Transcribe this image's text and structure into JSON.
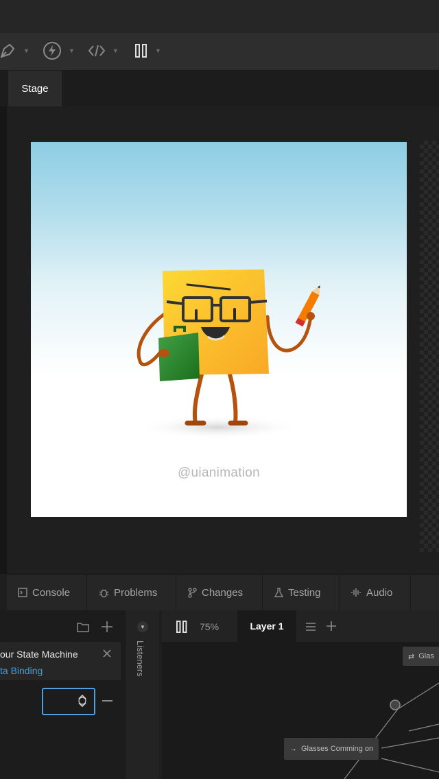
{
  "toolbar": {
    "icons": [
      "pen-icon",
      "bolt-icon",
      "code-icon",
      "pause-icon"
    ]
  },
  "stage_tab": {
    "label": "Stage"
  },
  "artboard": {
    "watermark": "@uianimation"
  },
  "bottom_tabs": [
    {
      "label": "Console",
      "icon": "console-icon"
    },
    {
      "label": "Problems",
      "icon": "bug-icon"
    },
    {
      "label": "Changes",
      "icon": "branch-icon"
    },
    {
      "label": "Testing",
      "icon": "flask-icon"
    },
    {
      "label": "Audio",
      "icon": "waveform-icon"
    }
  ],
  "left_panel": {
    "item_title": "our State Machine",
    "item_link": "ta Binding"
  },
  "listeners": {
    "label": "Listeners"
  },
  "graph": {
    "zoom": "75%",
    "layer_tab": "Layer 1",
    "node_top_right": "Glas",
    "node_bottom": "Glasses Comming on"
  },
  "colors": {
    "accent_link": "#3c9fe6",
    "focus_border": "#4f9ee8",
    "sticky_note": "#fbc02d",
    "bag": "#2e9a2a"
  }
}
